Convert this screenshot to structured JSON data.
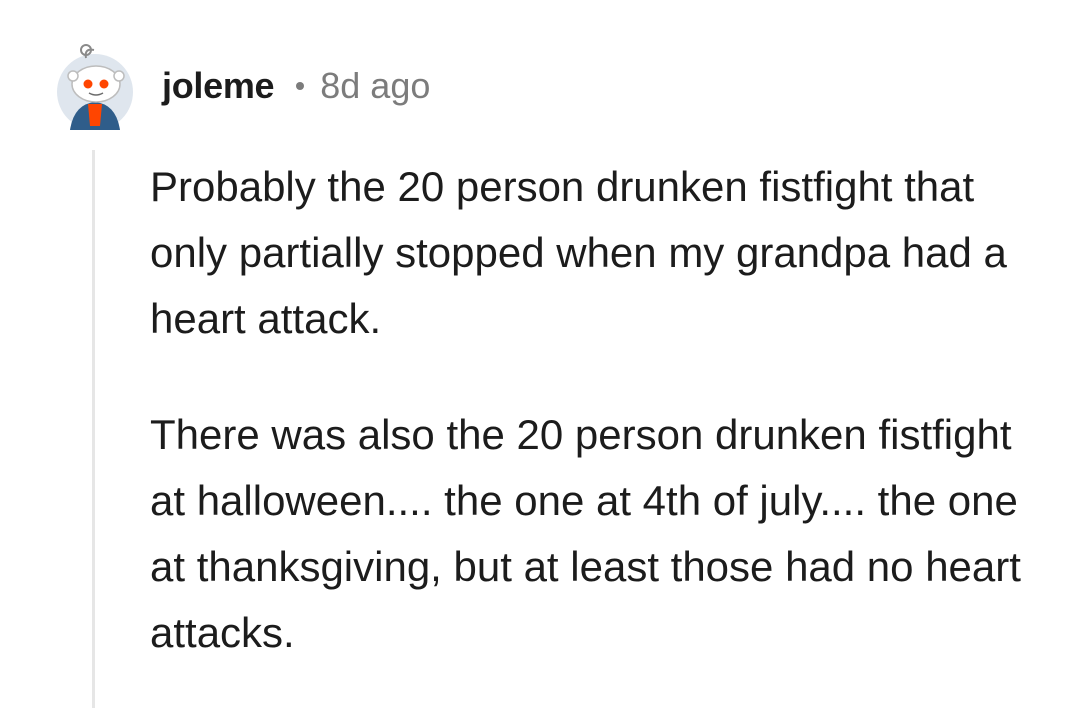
{
  "comment": {
    "author": "joleme",
    "timestamp": "8d ago",
    "avatar_icon": "snoo-avatar-icon",
    "paragraphs": [
      "Probably the 20 person drunken fistfight that only partially stopped when my grandpa had a heart attack.",
      "There was also the 20 person drunken fistfight at halloween.... the one at 4th of july.... the one at thanksgiving, but at least those had no heart attacks."
    ]
  },
  "colors": {
    "text": "#1c1c1c",
    "meta": "#7c7c7c",
    "thread_line": "#e6e6e6",
    "avatar_bg": "#d7dfe8",
    "avatar_accent": "#ff4500"
  }
}
